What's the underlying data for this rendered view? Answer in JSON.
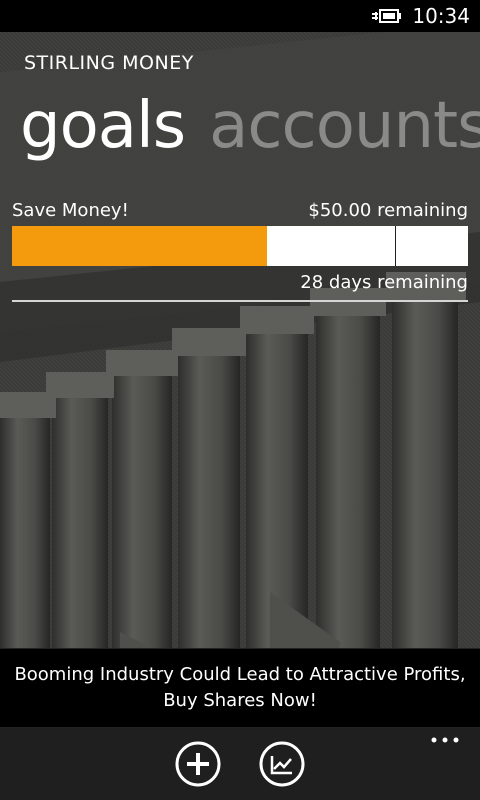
{
  "status_bar": {
    "time": "10:34",
    "battery_icon": "battery-charging-icon"
  },
  "app": {
    "title": "STIRLING MONEY"
  },
  "pivot": {
    "items": [
      {
        "label": "goals",
        "active": true
      },
      {
        "label": "accounts",
        "active": false
      }
    ]
  },
  "goal": {
    "name": "Save Money!",
    "amount_remaining": "$50.00 remaining",
    "days_remaining": "28 days remaining",
    "progress_fraction": 0.56,
    "marker_fraction": 0.84,
    "colors": {
      "progress_fill": "#f39a0d",
      "progress_track": "#ffffff"
    }
  },
  "ad": {
    "text": "Booming Industry Could Lead to Attractive Profits, Buy Shares Now!"
  },
  "app_bar": {
    "buttons": [
      {
        "icon": "add-icon"
      },
      {
        "icon": "chart-icon"
      }
    ],
    "more_icon": "ellipsis-icon"
  }
}
